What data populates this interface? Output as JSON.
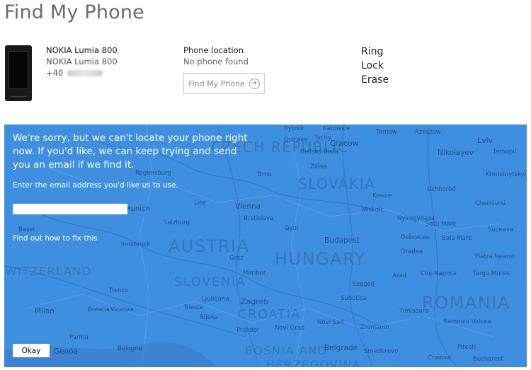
{
  "page": {
    "title": "Find My Phone"
  },
  "device": {
    "name": "NOKIA Lumia 800",
    "model": "NOKIA Lumia 800",
    "number_prefix": "+40"
  },
  "location": {
    "label": "Phone location",
    "status": "No phone found",
    "find_button": "Find My Phone"
  },
  "actions": {
    "ring": "Ring",
    "lock": "Lock",
    "erase": "Erase"
  },
  "dialog": {
    "message": "We're sorry, but we can't locate your phone right now. If you'd like, we can keep trying and send you an email if we find it.",
    "prompt": "Enter the email address you'd like us to use.",
    "email_value": "",
    "fix_link": "Find out how to fix this",
    "okay_button": "Okay"
  },
  "map": {
    "countries": [
      "SLOVAKIA",
      "AUSTRIA",
      "HUNGARY",
      "ROMANIA",
      "SLOVENIA",
      "CROATIA",
      "BOSNIA AND",
      "HERZEGOVINA",
      "SWITZERLAND",
      "CZECH REPUBLIC"
    ],
    "cities": [
      "Rybnik",
      "Katowice",
      "Cracow",
      "Tarnow",
      "Rzeszow",
      "Lviv",
      "Ostrava",
      "Tychy",
      "Bielsko-Biala",
      "Nikolayev",
      "Ternopil",
      "Khmelnytskyi",
      "Regensburg",
      "Brno",
      "Zilina",
      "Uzhhorod",
      "Chernivtsi",
      "Munich",
      "Linz",
      "Vienna",
      "Bratislava",
      "Kosice",
      "Miskolc",
      "Satu Mare",
      "Suceava",
      "Salzburg",
      "Nyiregyhaza",
      "Debrecen",
      "Baia Mare",
      "Basel",
      "Innsbruck",
      "Gyor",
      "Budapest",
      "Oradea",
      "Piatra Neamt",
      "Graz",
      "Maribor",
      "Szeged",
      "Arad",
      "Cluj-Napoca",
      "Targu Mures",
      "Trento",
      "Ljubljana",
      "Zagreb",
      "Subotica",
      "Timisoara",
      "Milan",
      "Brescia",
      "Vicenza",
      "Trieste",
      "Rijeka",
      "Novi Sad",
      "Zrenjanin",
      "Ramnicu Valcea",
      "Genoa",
      "Parma",
      "Bologna",
      "Prijedor",
      "Novi Grad",
      "Belgrade",
      "Smederevo",
      "Pitesti",
      "Craiova",
      "Bucharest"
    ]
  }
}
